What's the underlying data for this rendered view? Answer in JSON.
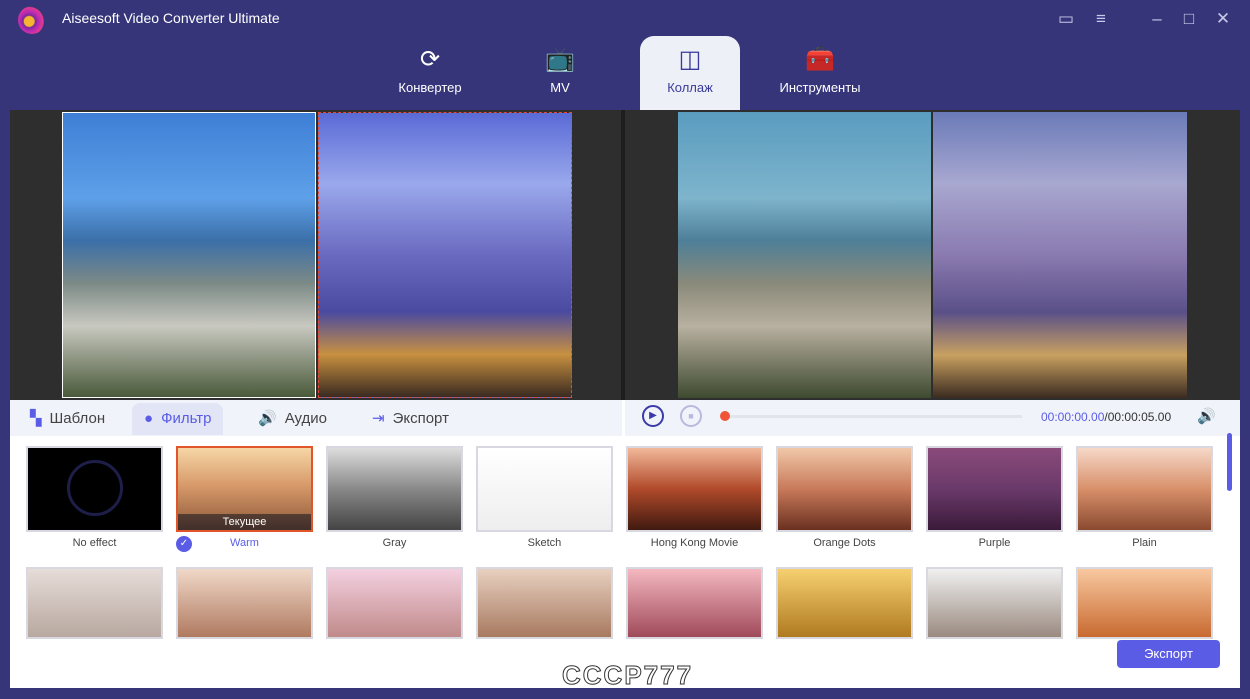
{
  "app": {
    "title": "Aiseesoft Video Converter Ultimate"
  },
  "nav": [
    {
      "label": "Конвертер",
      "icon": "convert-icon"
    },
    {
      "label": "MV",
      "icon": "tv-icon"
    },
    {
      "label": "Коллаж",
      "icon": "collage-icon"
    },
    {
      "label": "Инструменты",
      "icon": "toolbox-icon"
    }
  ],
  "tabs": [
    {
      "label": "Шаблон"
    },
    {
      "label": "Фильтр"
    },
    {
      "label": "Аудио"
    },
    {
      "label": "Экспорт"
    }
  ],
  "player": {
    "current": "00:00:00.00",
    "total": "/00:00:05.00",
    "progress": 0
  },
  "filters_row1": [
    {
      "label": "No effect"
    },
    {
      "label": "Warm",
      "badge": "Текущее",
      "selected": true
    },
    {
      "label": "Gray"
    },
    {
      "label": "Sketch"
    },
    {
      "label": "Hong Kong Movie"
    },
    {
      "label": "Orange Dots"
    },
    {
      "label": "Purple"
    },
    {
      "label": "Plain"
    }
  ],
  "export_button": "Экспорт",
  "watermark": "CCCP777"
}
